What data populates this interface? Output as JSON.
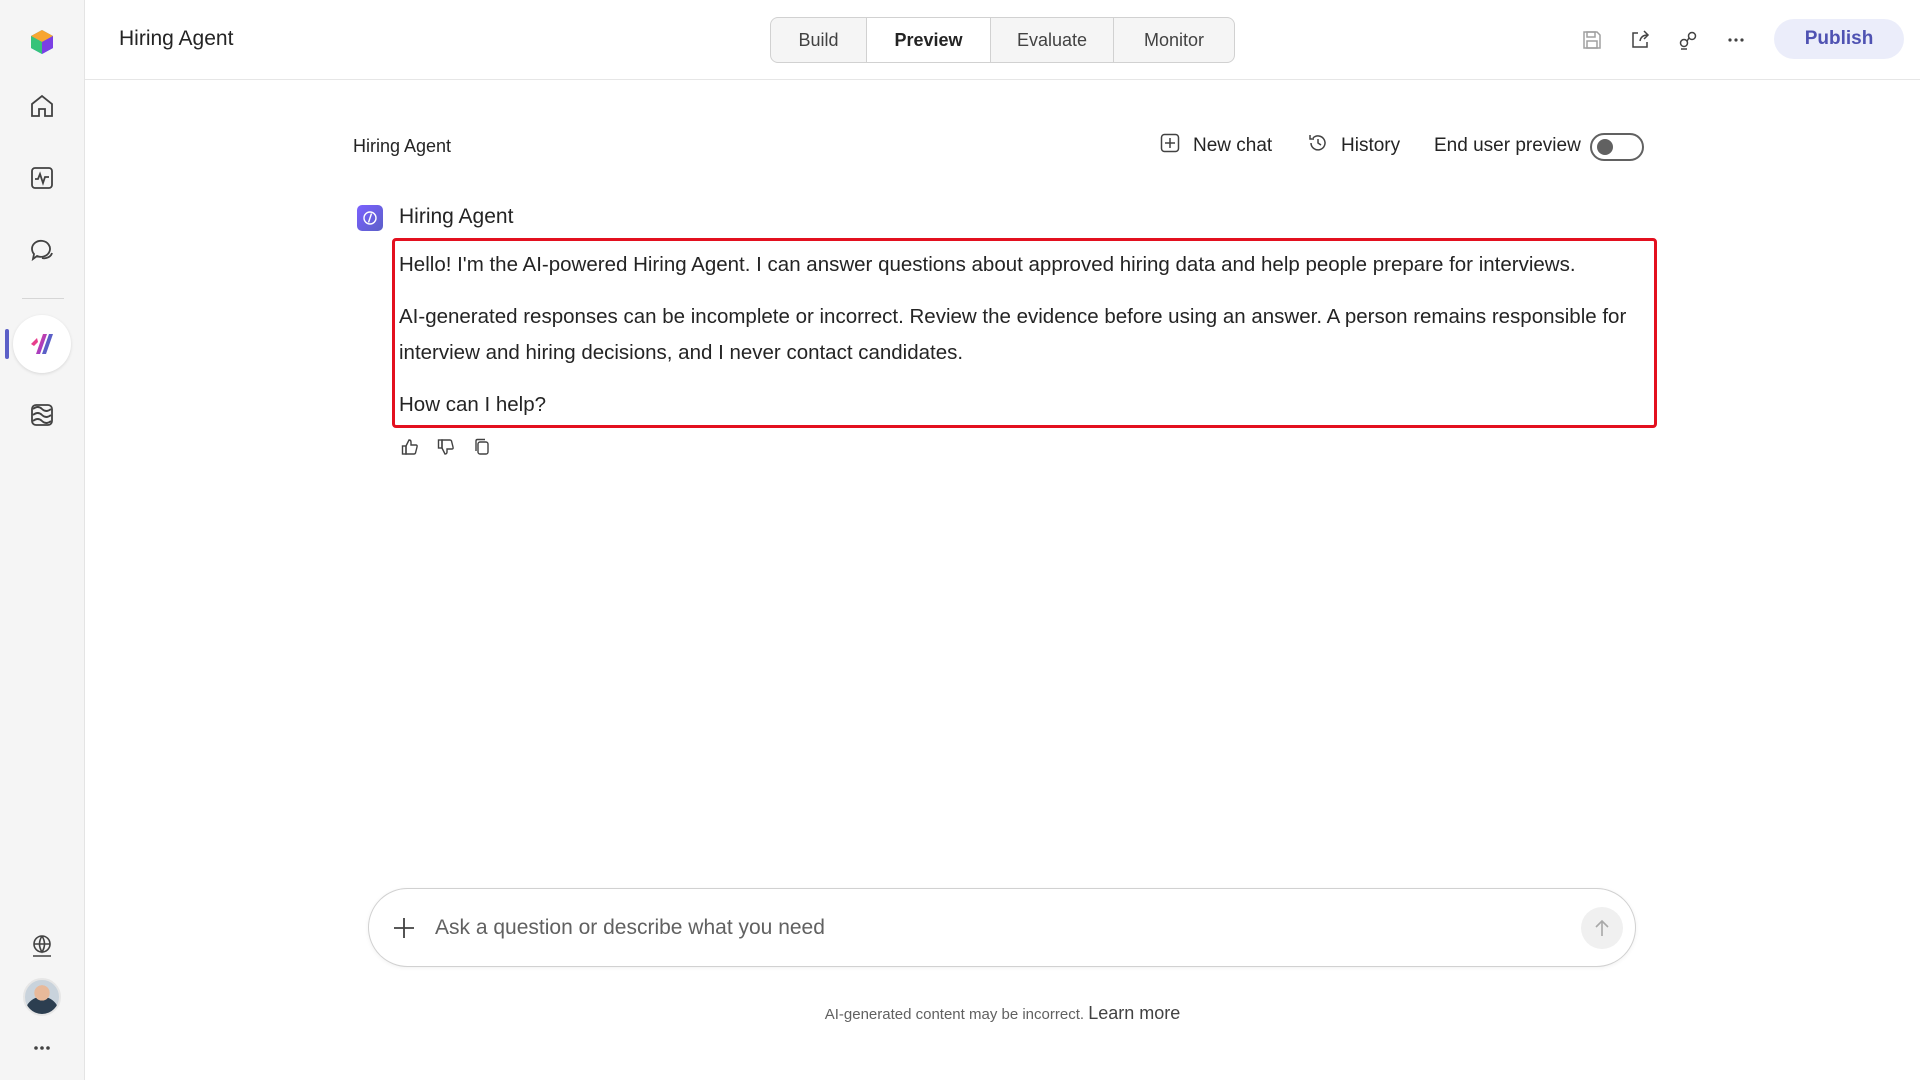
{
  "app": {
    "title": "Hiring Agent"
  },
  "tabs": [
    {
      "label": "Build"
    },
    {
      "label": "Preview"
    },
    {
      "label": "Evaluate"
    },
    {
      "label": "Monitor"
    }
  ],
  "active_tab": "Preview",
  "toolbar": {
    "publish_label": "Publish"
  },
  "chat_header": {
    "title": "Hiring Agent",
    "new_chat_label": "New chat",
    "history_label": "History",
    "end_user_preview_label": "End user preview",
    "end_user_preview_on": false
  },
  "message": {
    "sender": "Hiring Agent",
    "paragraphs": [
      "Hello! I'm the AI-powered Hiring Agent. I can answer questions about approved hiring data and help people prepare for interviews.",
      "AI-generated responses can be incomplete or incorrect. Review the evidence before using an answer. A person remains responsible for interview and hiring decisions, and I never contact candidates.",
      "How can I help?"
    ]
  },
  "composer": {
    "placeholder": "Ask a question or describe what you need"
  },
  "footer": {
    "note": "AI-generated content may be incorrect.",
    "link": "Learn more"
  },
  "colors": {
    "accent": "#5b5fc7",
    "highlight_border": "#e3101f",
    "publish_bg": "#ebedfa",
    "publish_text": "#4f52b2"
  }
}
